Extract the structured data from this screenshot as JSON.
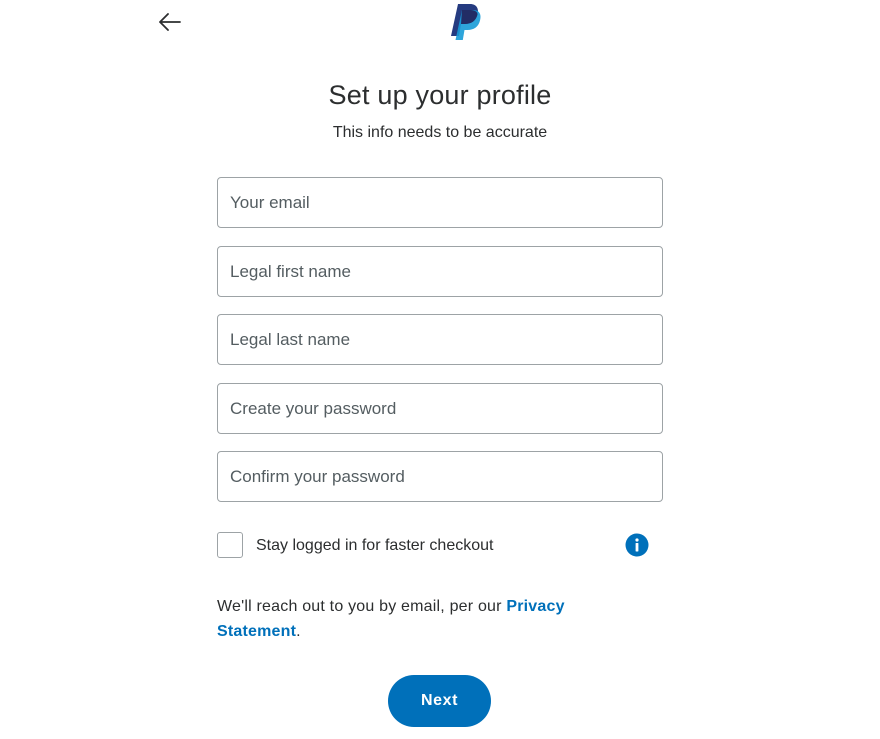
{
  "header": {
    "back_icon": "arrow-left-icon",
    "logo_icon": "paypal-logo-icon"
  },
  "title": "Set up your profile",
  "subtitle": "This info needs to be accurate",
  "fields": {
    "email": {
      "placeholder": "Your email",
      "value": ""
    },
    "first_name": {
      "placeholder": "Legal first name",
      "value": ""
    },
    "last_name": {
      "placeholder": "Legal last name",
      "value": ""
    },
    "password": {
      "placeholder": "Create your password",
      "value": ""
    },
    "confirm_password": {
      "placeholder": "Confirm your password",
      "value": ""
    }
  },
  "stay_logged_in": {
    "label": "Stay logged in for faster checkout",
    "checked": false,
    "info_icon": "info-icon"
  },
  "notice": {
    "text_before": "We'll reach out to you by email, per our ",
    "link_text": "Privacy Statement",
    "text_after": "."
  },
  "next_button": "Next",
  "colors": {
    "accent": "#0070ba",
    "text": "#2c2e2f",
    "border": "#9da3a6",
    "logo_dark": "#253b80",
    "logo_light": "#179bd7"
  }
}
